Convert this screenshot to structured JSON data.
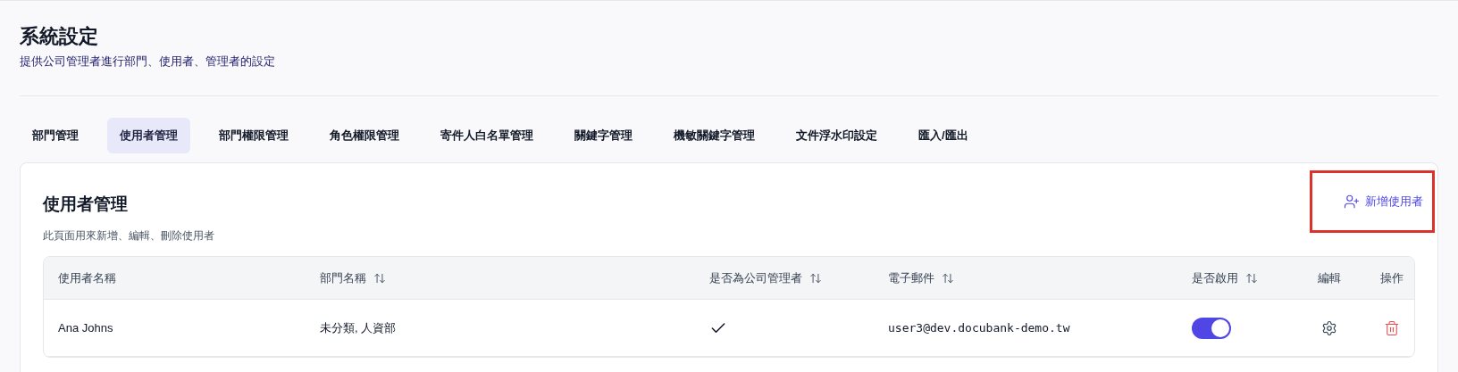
{
  "header": {
    "title": "系統設定",
    "subtitle": "提供公司管理者進行部門、使用者、管理者的設定"
  },
  "tabs": [
    {
      "label": "部門管理",
      "selected": false
    },
    {
      "label": "使用者管理",
      "selected": true
    },
    {
      "label": "部門權限管理",
      "selected": false
    },
    {
      "label": "角色權限管理",
      "selected": false
    },
    {
      "label": "寄件人白名單管理",
      "selected": false
    },
    {
      "label": "關鍵字管理",
      "selected": false
    },
    {
      "label": "機敏關鍵字管理",
      "selected": false
    },
    {
      "label": "文件浮水印設定",
      "selected": false
    },
    {
      "label": "匯入/匯出",
      "selected": false
    }
  ],
  "panel": {
    "title": "使用者管理",
    "description": "此頁面用來新增、編輯、刪除使用者",
    "add_button": {
      "label": "新增使用者",
      "highlighted": true
    }
  },
  "table": {
    "columns": [
      {
        "label": "使用者名稱",
        "sortable": false
      },
      {
        "label": "部門名稱",
        "sortable": true
      },
      {
        "label": "是否為公司管理者",
        "sortable": true
      },
      {
        "label": "電子郵件",
        "sortable": true
      },
      {
        "label": "是否啟用",
        "sortable": true
      },
      {
        "label": "編輯",
        "sortable": false
      },
      {
        "label": "操作",
        "sortable": false
      }
    ],
    "rows": [
      {
        "name": "Ana Johns",
        "department": "未分類, 人資部",
        "is_admin": true,
        "email": "user3@dev.docubank-demo.tw",
        "enabled": true
      }
    ]
  }
}
